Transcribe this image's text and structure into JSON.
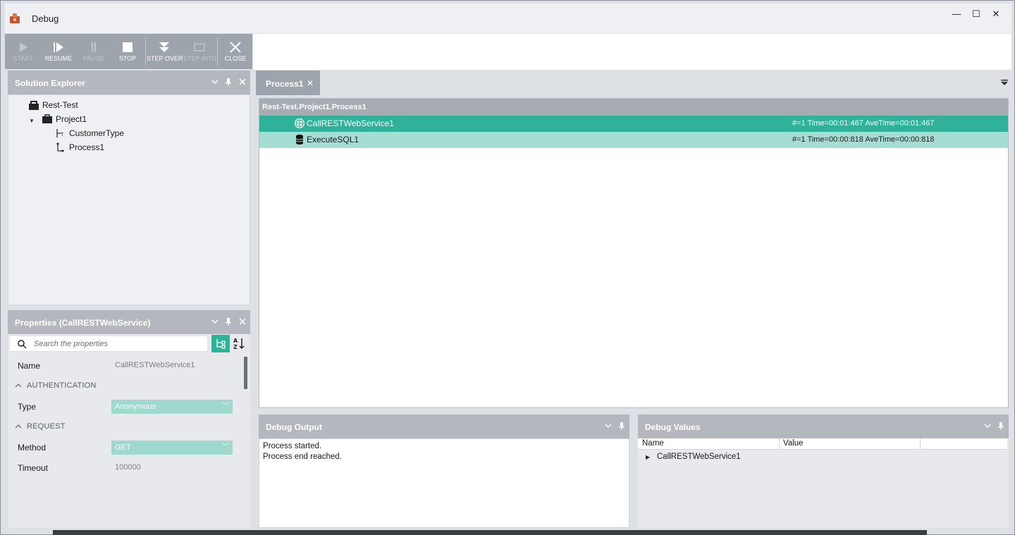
{
  "window": {
    "title": "Debug",
    "controls": {
      "minimize": "—",
      "maximize": "☐",
      "close": "✕"
    }
  },
  "toolbar": {
    "buttons": [
      {
        "label": "START",
        "icon": "play-icon",
        "enabled": false
      },
      {
        "label": "RESUME",
        "icon": "resume-icon",
        "enabled": true
      },
      {
        "label": "PAUSE",
        "icon": "pause-icon",
        "enabled": false
      },
      {
        "label": "STOP",
        "icon": "stop-icon",
        "enabled": true
      },
      {
        "label": "STEP OVER",
        "icon": "step-over-icon",
        "enabled": true
      },
      {
        "label": "STEP INTO",
        "icon": "step-into-icon",
        "enabled": false
      },
      {
        "label": "CLOSE",
        "icon": "close-icon",
        "enabled": true
      }
    ]
  },
  "solution_explorer": {
    "title": "Solution Explorer",
    "tree": {
      "root": "Rest-Test",
      "project": "Project1",
      "items": [
        "CustomerType",
        "Process1"
      ]
    }
  },
  "properties": {
    "title": "Properties (CallRESTWebService)",
    "search_placeholder": "Search the properties",
    "name_label": "Name",
    "name_value": "CallRESTWebService1",
    "categories": [
      {
        "label": "AUTHENTICATION",
        "props": [
          {
            "name": "Type",
            "value": "Anonymous"
          }
        ]
      },
      {
        "label": "REQUEST",
        "props": [
          {
            "name": "Method",
            "value": "GET"
          },
          {
            "name": "Timeout",
            "value": "100000"
          }
        ]
      }
    ]
  },
  "document": {
    "tab_label": "Process1",
    "tab_close": "✕",
    "breadcrumb": "Rest-Test.Project1.Process1",
    "steps": [
      {
        "name": "CallRESTWebService1",
        "stats": "#=1 Time=00:01:467 AveTime=00:01:467",
        "state": "active",
        "icon": "web-service-icon"
      },
      {
        "name": "ExecuteSQL1",
        "stats": "#=1 Time=00:00:818 AveTime=00:00:818",
        "state": "done",
        "icon": "database-icon"
      }
    ]
  },
  "debug_output": {
    "title": "Debug Output",
    "lines": [
      "Process started.",
      "Process end reached."
    ]
  },
  "debug_values": {
    "title": "Debug Values",
    "columns": [
      "Name",
      "Value"
    ],
    "rows": [
      {
        "name": "CallRESTWebService1"
      }
    ]
  },
  "colors": {
    "accent": "#2fb299",
    "accent_light": "#a6ddd3",
    "panel_header": "#b4b8be",
    "toolbar": "#9ea4ab"
  }
}
